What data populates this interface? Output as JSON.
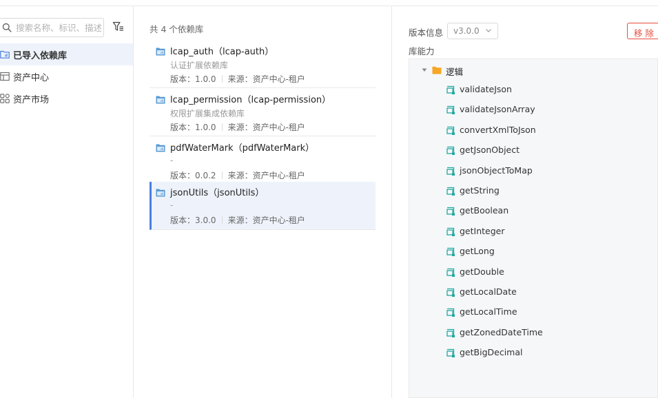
{
  "sidebar": {
    "search": {
      "placeholder": "搜索名称、标识、描述",
      "value": "",
      "icon": "search-icon"
    },
    "filter_icon": "filter-icon",
    "items": [
      {
        "label": "已导入依赖库",
        "icon": "folder-library-icon",
        "active": true
      },
      {
        "label": "资产中心",
        "icon": "table-icon",
        "active": false
      },
      {
        "label": "资产市场",
        "icon": "grid-icon",
        "active": false
      }
    ]
  },
  "library_list": {
    "count_text": "共 4 个依赖库",
    "version_prefix": "版本：",
    "source_prefix": "来源：",
    "items": [
      {
        "name": "lcap_auth（lcap-auth）",
        "description": "认证扩展依赖库",
        "version": "1.0.0",
        "source": "资产中心-租户",
        "selected": false
      },
      {
        "name": "lcap_permission（lcap-permission）",
        "description": "权限扩展集成依赖库",
        "version": "1.0.0",
        "source": "资产中心-租户",
        "selected": false
      },
      {
        "name": "pdfWaterMark（pdfWaterMark）",
        "description": "-",
        "version": "0.0.2",
        "source": "资产中心-租户",
        "selected": false
      },
      {
        "name": "jsonUtils（jsonUtils）",
        "description": "-",
        "version": "3.0.0",
        "source": "资产中心-租户",
        "selected": true
      }
    ]
  },
  "detail": {
    "version_label": "版本信息",
    "version_value": "v3.0.0",
    "remove_label": "移除",
    "capability_label": "库能力",
    "tree": {
      "folder": {
        "label": "逻辑",
        "expanded": true,
        "icon": "folder-icon"
      },
      "items": [
        "validateJson",
        "validateJsonArray",
        "convertXmlToJson",
        "getJsonObject",
        "jsonObjectToMap",
        "getString",
        "getBoolean",
        "getInteger",
        "getLong",
        "getDouble",
        "getLocalDate",
        "getLocalTime",
        "getZonedDateTime",
        "getBigDecimal"
      ]
    }
  },
  "colors": {
    "accent": "#4a7ee0",
    "active_bg": "#eef3fb",
    "danger": "#e74c3c",
    "folder": "#f5a623",
    "logic_icon": "#1fa9a0"
  }
}
